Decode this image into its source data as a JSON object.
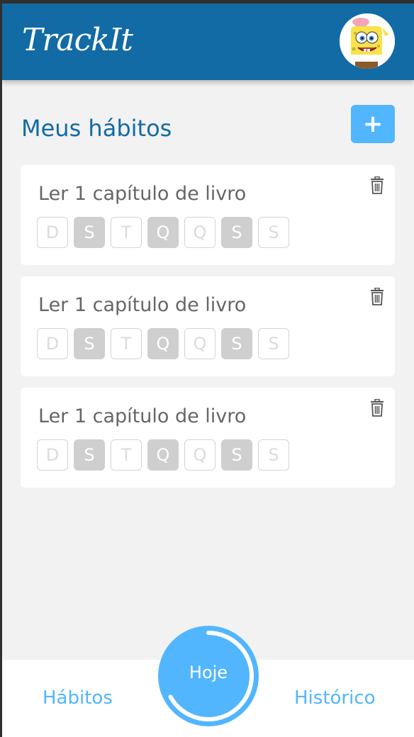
{
  "header": {
    "logo": "TrackIt"
  },
  "page": {
    "title": "Meus hábitos",
    "add_label": "+"
  },
  "habits": [
    {
      "name": "Ler 1 capítulo de livro",
      "days": [
        {
          "label": "D",
          "selected": false
        },
        {
          "label": "S",
          "selected": true
        },
        {
          "label": "T",
          "selected": false
        },
        {
          "label": "Q",
          "selected": true
        },
        {
          "label": "Q",
          "selected": false
        },
        {
          "label": "S",
          "selected": true
        },
        {
          "label": "S",
          "selected": false
        }
      ]
    },
    {
      "name": "Ler 1 capítulo de livro",
      "days": [
        {
          "label": "D",
          "selected": false
        },
        {
          "label": "S",
          "selected": true
        },
        {
          "label": "T",
          "selected": false
        },
        {
          "label": "Q",
          "selected": true
        },
        {
          "label": "Q",
          "selected": false
        },
        {
          "label": "S",
          "selected": true
        },
        {
          "label": "S",
          "selected": false
        }
      ]
    },
    {
      "name": "Ler 1 capítulo de livro",
      "days": [
        {
          "label": "D",
          "selected": false
        },
        {
          "label": "S",
          "selected": true
        },
        {
          "label": "T",
          "selected": false
        },
        {
          "label": "Q",
          "selected": true
        },
        {
          "label": "Q",
          "selected": false
        },
        {
          "label": "S",
          "selected": true
        },
        {
          "label": "S",
          "selected": false
        }
      ]
    }
  ],
  "footer": {
    "habits_label": "Hábitos",
    "today_label": "Hoje",
    "history_label": "Histórico",
    "today_progress": 0.67
  },
  "colors": {
    "header": "#126ba5",
    "accent": "#52b6ff",
    "day_selected": "#cfcfcf",
    "day_unselected_text": "#dbdbdb"
  }
}
